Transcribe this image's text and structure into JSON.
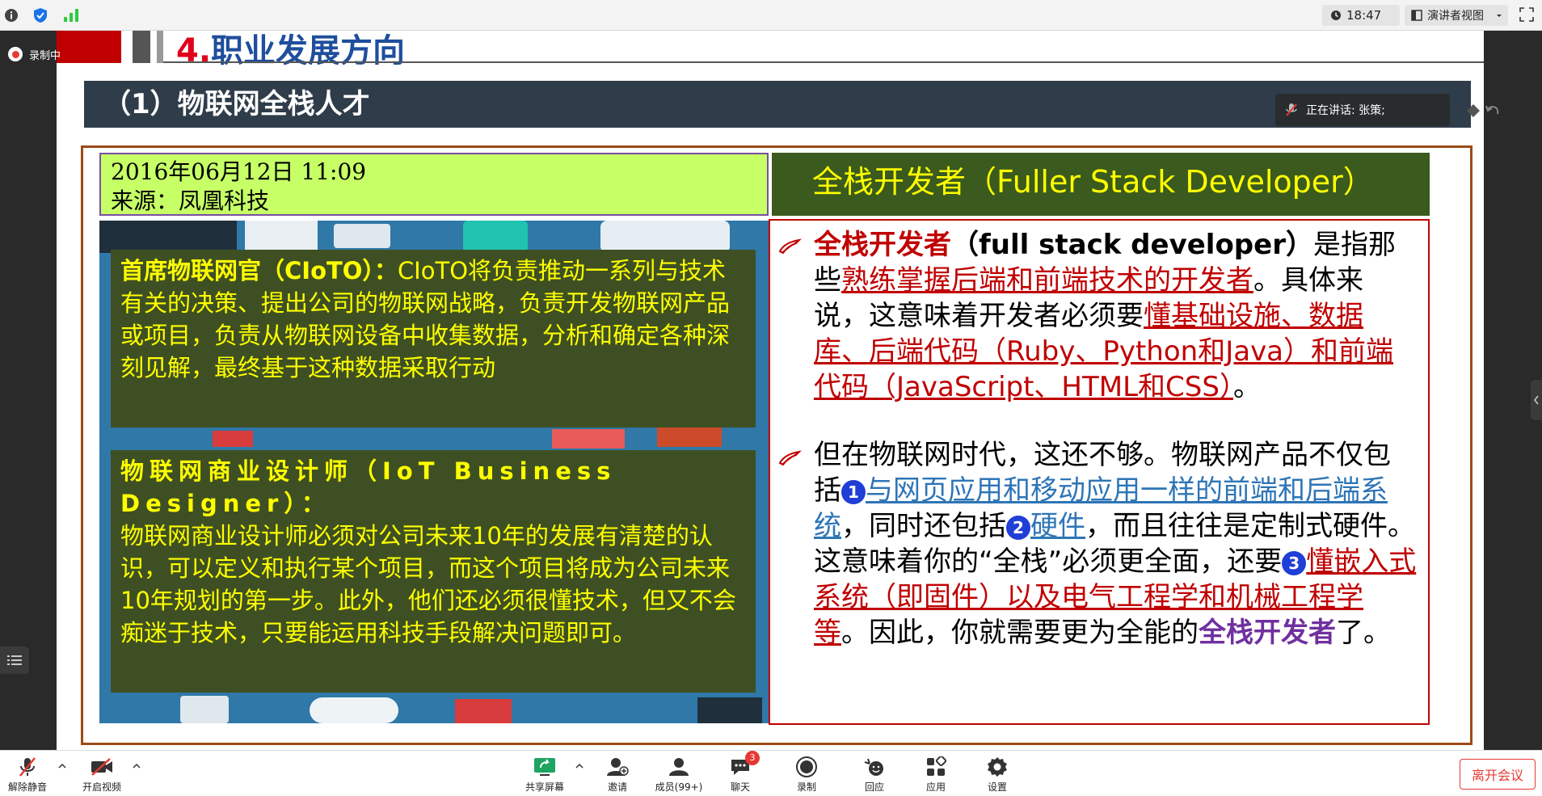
{
  "topbar": {
    "clock_time": "18:47",
    "view_mode": "演讲者视图"
  },
  "recording": {
    "label": "录制中"
  },
  "slide": {
    "title_num": "4.",
    "title_text": "职业发展方向",
    "section_heading": "（1）物联网全栈人才",
    "date_line1": "2016年06月12日 11:09",
    "date_line2": "来源：凤凰科技",
    "cioto": {
      "heading": "首席物联网官（CIoTO）：",
      "body": "CIoTO将负责推动一系列与技术有关的决策、提出公司的物联网战略，负责开发物联网产品或项目，负责从物联网设备中收集数据，分析和确定各种深刻见解，最终基于这种数据采取行动"
    },
    "iot_designer": {
      "heading": "物联网商业设计师（IoT Business Designer）：",
      "body": "物联网商业设计师必须对公司未来10年的发展有清楚的认识，可以定义和执行某个项目，而这个项目将成为公司未来10年规划的第一步。此外，他们还必须很懂技术，但又不会痴迷于技术，只要能运用科技手段解决问题即可。"
    },
    "right_header": "全栈开发者（Fuller Stack Developer）",
    "para1": {
      "term": "全栈开发者",
      "term_en": "（full stack developer）",
      "t1": "是指那些",
      "u1": "熟练掌握后端和前端技术的开发者",
      "t2": "。具体来说，这意味着开发者必须要",
      "u2": "懂基础设施、数据库、后端代码（Ruby、Python和Java）和前端代码（JavaScript、HTML和CSS）",
      "t3": "。"
    },
    "para2": {
      "t1": "但在物联网时代，这还不够。物联网产品不仅包括",
      "n1": "1",
      "u1": "与网页应用和移动应用一样的前端和后端系统",
      "t2": "，同时还包括",
      "n2": "2",
      "u2": "硬件",
      "t3": "，而且往往是定制式硬件。这意味着你的“全栈”必须更全面，还要",
      "n3": "3",
      "u3": "懂嵌入式系统（即固件）以及电气工程学和机械工程学等",
      "t4": "。因此，你就需要更为全能的",
      "term": "全栈开发者",
      "t5": "了。"
    }
  },
  "speaking": {
    "label": "正在讲话: 张策;"
  },
  "toolbar": {
    "unmute": "解除静音",
    "start_video": "开启视频",
    "share_screen": "共享屏幕",
    "invite": "邀请",
    "members": "成员(99+)",
    "chat": "聊天",
    "chat_badge": "3",
    "record": "录制",
    "react": "回应",
    "apps": "应用",
    "settings": "设置",
    "leave": "离开会议"
  }
}
